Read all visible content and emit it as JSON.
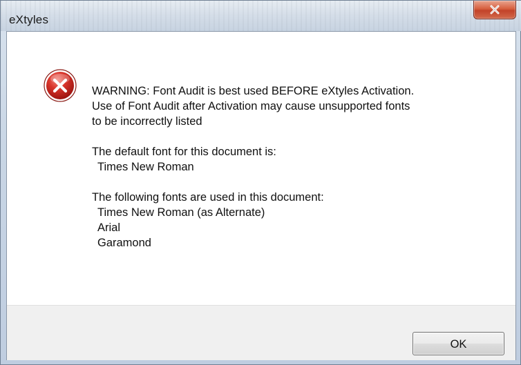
{
  "window": {
    "title": "eXtyles"
  },
  "icons": {
    "close": "close-icon",
    "error": "error-icon"
  },
  "message": {
    "warning_line1": "WARNING: Font Audit is best used BEFORE eXtyles Activation.",
    "warning_line2": "Use of Font Audit after Activation may cause unsupported fonts",
    "warning_line3": "to be incorrectly listed",
    "default_font_label": "The default font for this document is:",
    "default_font": "Times New Roman",
    "used_fonts_label": "The following fonts are used in this document:",
    "used_fonts": [
      "Times New Roman (as Alternate)",
      "Arial",
      "Garamond"
    ]
  },
  "buttons": {
    "ok_label": "OK"
  },
  "colors": {
    "error_red": "#c62828",
    "close_red": "#c7472d"
  }
}
